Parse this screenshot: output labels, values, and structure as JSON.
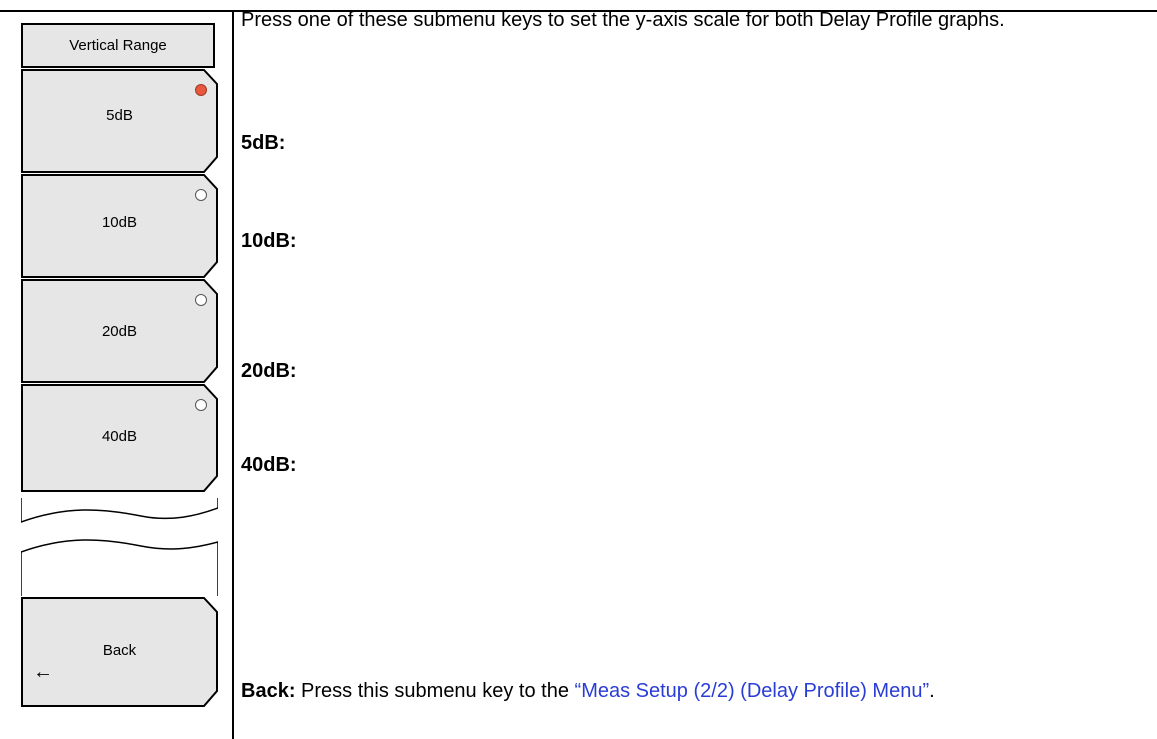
{
  "menu": {
    "title": "Vertical Range",
    "keys": [
      {
        "label": "5dB",
        "selected": true
      },
      {
        "label": "10dB",
        "selected": false
      },
      {
        "label": "20dB",
        "selected": false
      },
      {
        "label": "40dB",
        "selected": false
      }
    ],
    "back_label": "Back",
    "back_arrow": "←"
  },
  "description": {
    "intro": "Press one of these submenu keys to set the y-axis scale for both Delay Profile graphs.",
    "terms": [
      "5dB:",
      "10dB:",
      "20dB:",
      "40dB:"
    ],
    "back_term": "Back:",
    "back_text": "Press this submenu key to the",
    "back_link": "“Meas Setup (2/2) (Delay Profile) Menu”",
    "back_end": "."
  },
  "colors": {
    "selected_led": "#e8583e",
    "link": "#2a3cd6",
    "key_fill": "#e6e6e6"
  }
}
